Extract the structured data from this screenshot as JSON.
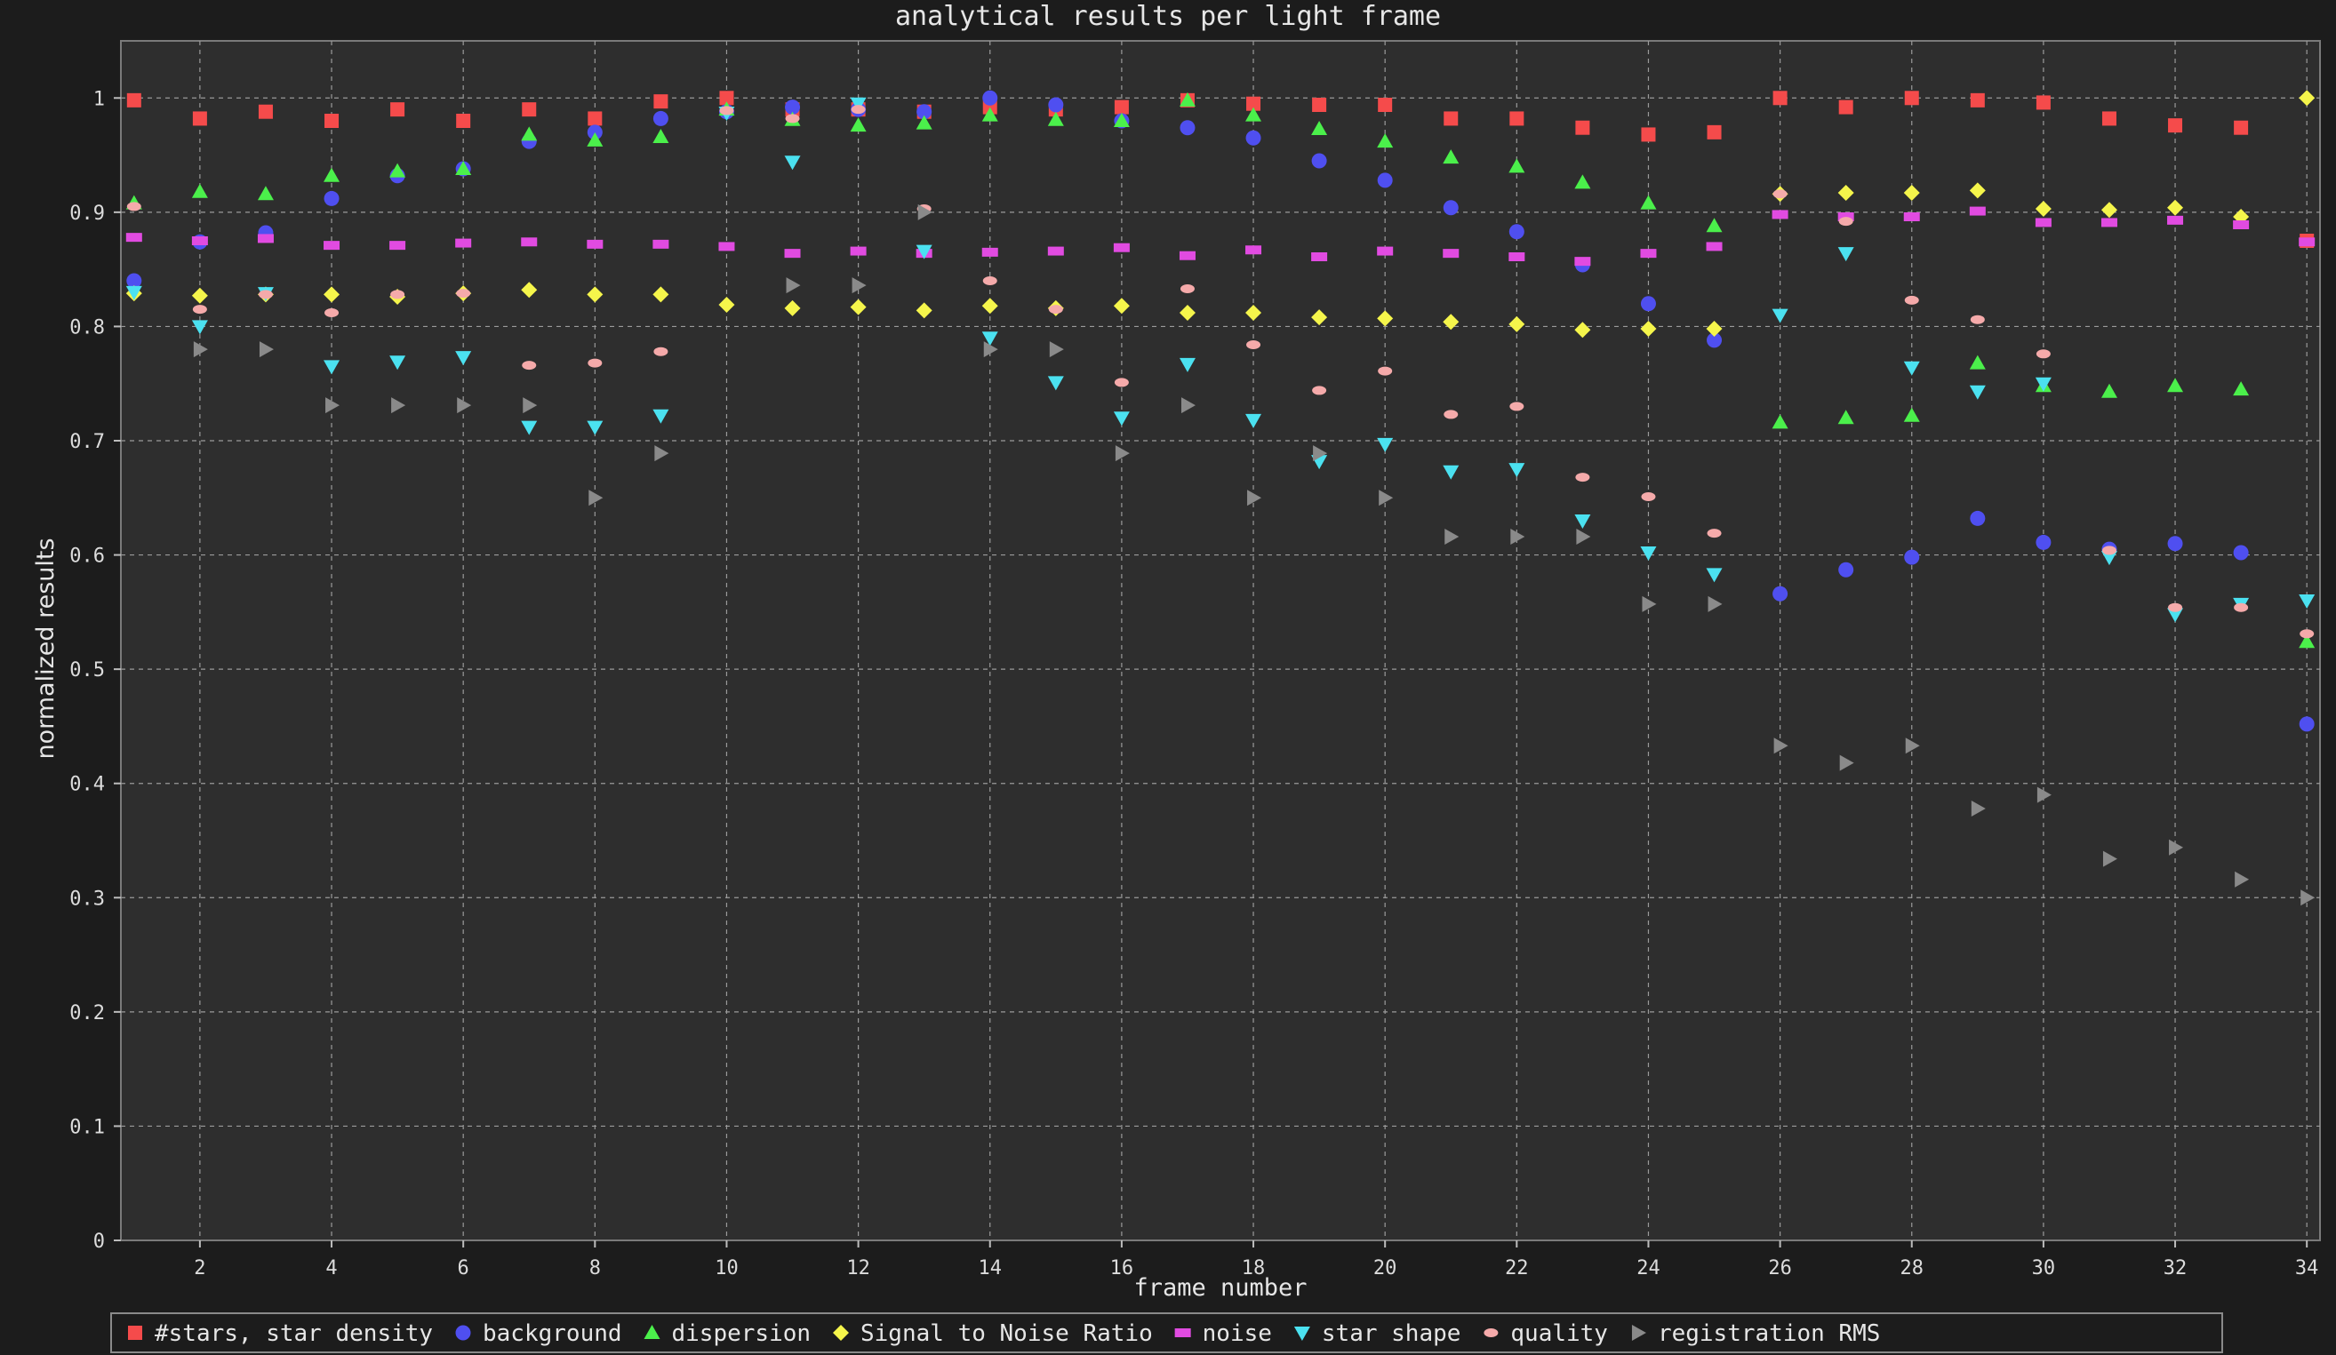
{
  "chart_data": {
    "type": "scatter",
    "title": "analytical results per light frame",
    "xlabel": "frame number",
    "ylabel": "normalized results",
    "xlim": [
      0.8,
      34.2
    ],
    "ylim": [
      0,
      1.05
    ],
    "xticks": [
      2,
      4,
      6,
      8,
      10,
      12,
      14,
      16,
      18,
      20,
      22,
      24,
      26,
      28,
      30,
      32,
      34
    ],
    "yticks": [
      0,
      0.1,
      0.2,
      0.3,
      0.4,
      0.5,
      0.6,
      0.7,
      0.8,
      0.9,
      1
    ],
    "grid": true,
    "legend_position": "bottom",
    "x": [
      1,
      2,
      3,
      4,
      5,
      6,
      7,
      8,
      9,
      10,
      11,
      12,
      13,
      14,
      15,
      16,
      17,
      18,
      19,
      20,
      21,
      22,
      23,
      24,
      25,
      26,
      27,
      28,
      29,
      30,
      31,
      32,
      33,
      34
    ],
    "series": [
      {
        "name": "#stars, star density",
        "marker": "square",
        "color": "#f54b4b",
        "values": [
          0.998,
          0.982,
          0.988,
          0.98,
          0.99,
          0.98,
          0.99,
          0.982,
          0.997,
          1.0,
          0.99,
          0.99,
          0.988,
          0.992,
          0.99,
          0.992,
          0.998,
          0.995,
          0.994,
          0.994,
          0.982,
          0.982,
          0.974,
          0.968,
          0.97,
          1.0,
          0.992,
          1.0,
          0.998,
          0.996,
          0.982,
          0.976,
          0.974,
          0.875
        ]
      },
      {
        "name": "background",
        "marker": "circle",
        "color": "#4f4ff0",
        "values": [
          0.84,
          0.874,
          0.882,
          0.912,
          0.932,
          0.938,
          0.962,
          0.97,
          0.982,
          0.988,
          0.992,
          0.99,
          0.988,
          1.0,
          0.994,
          0.98,
          0.974,
          0.965,
          0.945,
          0.928,
          0.904,
          0.883,
          0.854,
          0.82,
          0.788,
          0.566,
          0.587,
          0.598,
          0.632,
          0.611,
          0.605,
          0.61,
          0.602,
          0.452
        ]
      },
      {
        "name": "dispersion",
        "marker": "triangle-up",
        "color": "#4bf04b",
        "values": [
          0.908,
          0.918,
          0.916,
          0.932,
          0.936,
          0.938,
          0.968,
          0.963,
          0.966,
          0.99,
          0.981,
          0.976,
          0.978,
          0.985,
          0.981,
          0.98,
          0.998,
          0.985,
          0.973,
          0.962,
          0.948,
          0.94,
          0.926,
          0.908,
          0.888,
          0.716,
          0.72,
          0.722,
          0.768,
          0.748,
          0.743,
          0.748,
          0.745,
          0.524
        ]
      },
      {
        "name": "Signal to Noise Ratio",
        "marker": "diamond",
        "color": "#f5f54b",
        "values": [
          0.829,
          0.827,
          0.828,
          0.828,
          0.826,
          0.829,
          0.832,
          0.828,
          0.828,
          0.819,
          0.816,
          0.817,
          0.814,
          0.818,
          0.816,
          0.818,
          0.812,
          0.812,
          0.808,
          0.807,
          0.804,
          0.802,
          0.797,
          0.798,
          0.798,
          0.916,
          0.917,
          0.917,
          0.919,
          0.903,
          0.902,
          0.904,
          0.896,
          1.0
        ]
      },
      {
        "name": "noise",
        "marker": "dash",
        "color": "#e14be1",
        "values": [
          0.878,
          0.875,
          0.877,
          0.871,
          0.871,
          0.873,
          0.874,
          0.872,
          0.872,
          0.87,
          0.864,
          0.866,
          0.864,
          0.865,
          0.866,
          0.869,
          0.862,
          0.867,
          0.861,
          0.866,
          0.864,
          0.861,
          0.857,
          0.864,
          0.87,
          0.898,
          0.896,
          0.896,
          0.901,
          0.891,
          0.891,
          0.893,
          0.889,
          0.874
        ]
      },
      {
        "name": "star shape",
        "marker": "triangle-down",
        "color": "#4be1f0",
        "values": [
          0.83,
          0.8,
          0.829,
          0.765,
          0.769,
          0.773,
          0.712,
          0.712,
          0.722,
          0.987,
          0.944,
          0.995,
          0.866,
          0.79,
          0.751,
          0.72,
          0.767,
          0.718,
          0.682,
          0.697,
          0.673,
          0.675,
          0.63,
          0.602,
          0.583,
          0.81,
          0.864,
          0.764,
          0.743,
          0.75,
          0.598,
          0.548,
          0.557,
          0.56
        ]
      },
      {
        "name": "quality",
        "marker": "ellipse",
        "color": "#f5aaaa",
        "values": [
          0.905,
          0.815,
          0.828,
          0.812,
          0.828,
          0.829,
          0.766,
          0.768,
          0.778,
          0.989,
          0.982,
          0.99,
          0.903,
          0.84,
          0.815,
          0.751,
          0.833,
          0.784,
          0.744,
          0.761,
          0.723,
          0.73,
          0.668,
          0.651,
          0.619,
          0.916,
          0.892,
          0.823,
          0.806,
          0.776,
          0.604,
          0.554,
          0.554,
          0.531
        ]
      },
      {
        "name": "registration RMS",
        "marker": "triangle-right",
        "color": "#8a8a8a",
        "values": [
          null,
          0.78,
          0.78,
          0.731,
          0.731,
          0.731,
          0.731,
          0.65,
          0.689,
          null,
          0.836,
          0.836,
          0.9,
          0.78,
          0.78,
          0.689,
          0.731,
          0.65,
          0.689,
          0.65,
          0.616,
          0.616,
          0.616,
          0.557,
          0.557,
          0.433,
          0.418,
          0.433,
          0.378,
          0.39,
          0.334,
          0.344,
          0.316,
          0.3
        ]
      }
    ]
  }
}
